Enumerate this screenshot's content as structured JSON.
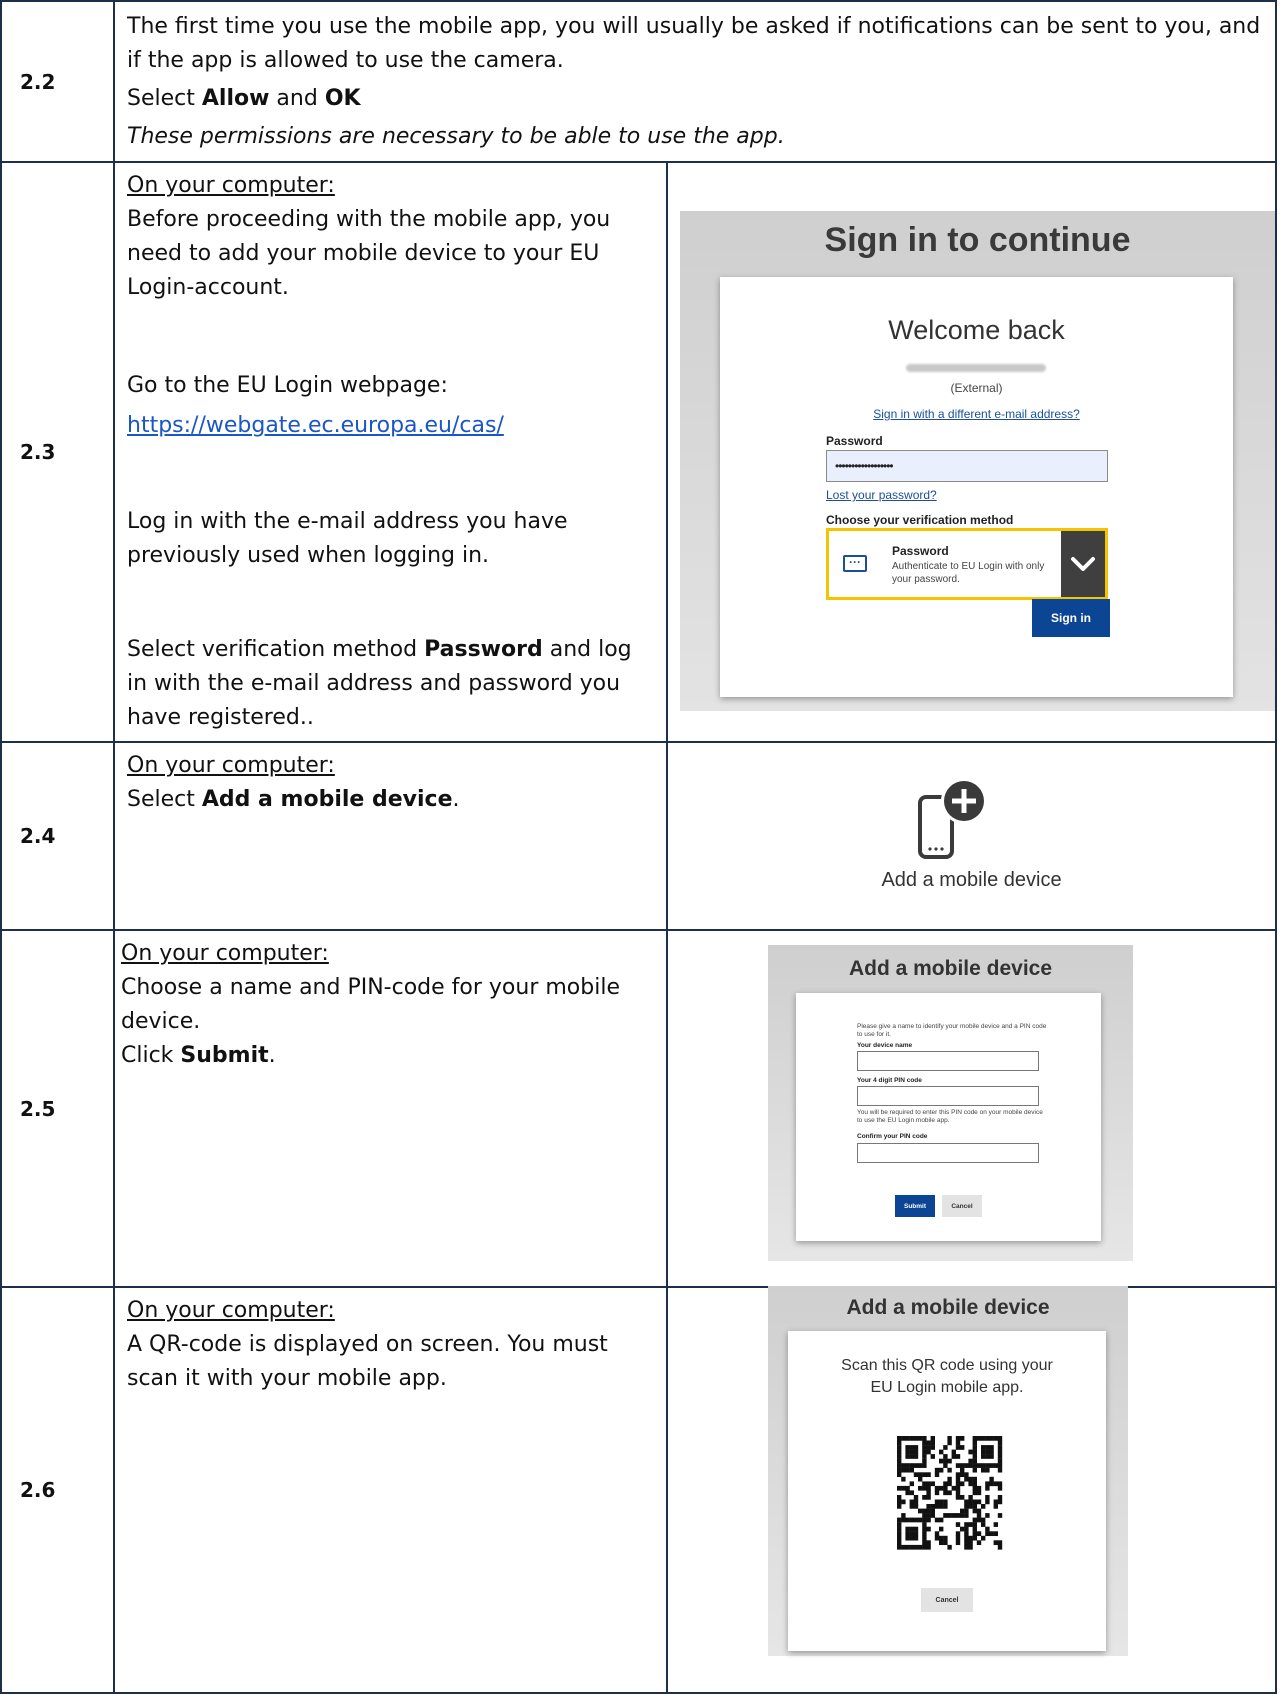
{
  "rows": [
    {
      "number": "2.2",
      "line1": "The first time you use the mobile app, you will usually be asked if notifications can be sent to you, and if the app is allowed to use the camera.",
      "select_prefix": "Select ",
      "allow": "Allow",
      "and": " and ",
      "ok": "OK",
      "note": "These permissions are necessary to be able to use the app."
    },
    {
      "number": "2.3",
      "heading": "On your computer:",
      "p1": "Before proceeding with the mobile app, you need to add your mobile device to your EU Login-account.",
      "p2": "Go to the EU Login webpage:",
      "link": "https://webgate.ec.europa.eu/cas/",
      "p3": "Log in with the e-mail address you have previously used when logging in.",
      "p4_prefix": "Select verification method ",
      "p4_bold": "Password",
      "p4_suffix": " and log in with the e-mail address and password you have registered.."
    },
    {
      "number": "2.4",
      "heading": "On your computer:",
      "select_prefix": "Select ",
      "bold": "Add a mobile device",
      "suffix": "."
    },
    {
      "number": "2.5",
      "heading": "On your computer:",
      "p1": "Choose a name and PIN-code for your mobile device.",
      "click_prefix": "Click ",
      "bold": "Submit",
      "suffix": "."
    },
    {
      "number": "2.6",
      "heading": "On your computer:",
      "p1": "A QR-code is displayed on screen. You must scan it with your mobile app."
    }
  ],
  "signin_screenshot": {
    "title": "Sign in to continue",
    "welcome": "Welcome back",
    "external": "(External)",
    "different_email": "Sign in with a different e-mail address?",
    "password_label": "Password",
    "password_value": "••••••••••••••••••",
    "lost_password": "Lost your password?",
    "choose_method": "Choose your verification method",
    "method_title": "Password",
    "method_desc": "Authenticate to EU Login with only your password.",
    "sign_in": "Sign in"
  },
  "add_device_icon": {
    "label": "Add a mobile device"
  },
  "add_device_form": {
    "title": "Add a mobile device",
    "intro": "Please give a name to identify your mobile device and a PIN code to use for it.",
    "device_name_label": "Your device name",
    "pin_label": "Your 4 digit PIN code",
    "pin_help": "You will be required to enter this PIN code on your mobile device to use the EU Login mobile app.",
    "confirm_label": "Confirm your PIN code",
    "submit": "Submit",
    "cancel": "Cancel"
  },
  "qr_screenshot": {
    "title": "Add a mobile device",
    "instruction": "Scan this QR code using your EU Login mobile app.",
    "cancel": "Cancel"
  },
  "colors": {
    "border": "#1f2f4a",
    "link": "#1a56c6",
    "eu_blue": "#0d4595",
    "highlight": "#f2c500"
  }
}
